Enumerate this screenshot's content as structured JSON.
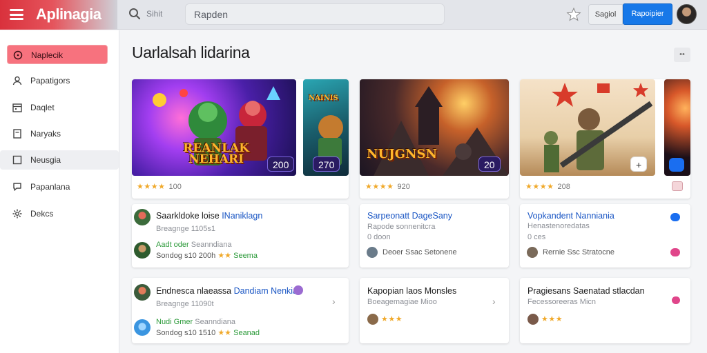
{
  "app": {
    "title": "Aplinagia"
  },
  "search": {
    "label": "Sihit",
    "value": "Rapden"
  },
  "header": {
    "secondary_button": "Sagiol",
    "primary_button": "Rapoipier"
  },
  "sidebar": {
    "items": [
      {
        "label": "Naplecik",
        "icon": "circle-dot-icon"
      },
      {
        "label": "Papatigors",
        "icon": "user-icon"
      },
      {
        "label": "Daqlet",
        "icon": "calendar-icon"
      },
      {
        "label": "Naryaks",
        "icon": "book-icon"
      },
      {
        "label": "Neusgia",
        "icon": "square-icon"
      },
      {
        "label": "Papanlana",
        "icon": "speech-bubble-icon"
      },
      {
        "label": "Dekcs",
        "icon": "gear-icon"
      }
    ]
  },
  "main": {
    "title": "Uarlalsah lidarina",
    "more_label": "••"
  },
  "cards": [
    {
      "banner_text": "REANLAK NEHARI",
      "badge": "200",
      "badge2": "270",
      "side_text": "NAINIS",
      "stars": "★★★★",
      "rating_count": "100"
    },
    {
      "banner_text": "NUJGNSN",
      "badge": "20",
      "stars": "★★★★",
      "rating_count": "920"
    },
    {
      "badge": "+",
      "stars": "★★★★",
      "rating_count": "208"
    }
  ],
  "rows": [
    {
      "title_plain": "Saarkldoke loise ",
      "title_blue": "INaniklagn",
      "sub": "Breagnge 1105s1",
      "green": "Aadt oder",
      "green_after": "Seanndiana",
      "meta": "Sondog s10 200h",
      "meta_green": "Seema"
    },
    {
      "title_blue": "Sarpeonatt DageSany",
      "sub": "Rapode sonnenitcra",
      "sub2": "0 doon",
      "meta": "Deoer Ssac Setonene"
    },
    {
      "title_blue": "Vopkandent Nanniania",
      "sub": "Henastenoredatas",
      "sub2": "0 ces",
      "meta": "Rernie Ssc Stratocne"
    },
    {
      "title_plain": "Endnesca nlaeassa ",
      "title_blue": "Dandiam Nenkia",
      "sub": "Breagnge 11090t",
      "green": "Nudi Gmer",
      "green_after": "Seanndiana",
      "meta": "Sondog s10 1510",
      "meta_green": "Seanad"
    },
    {
      "title_plain": "Kapopian laos Monsles",
      "sub": "Boeagemagiae Mioo",
      "stars": "★★★"
    },
    {
      "title_plain": "Pragiesans Saenatad stlacdan",
      "sub": "Fecessoreeras Micn",
      "stars": "★★★"
    }
  ],
  "colors": {
    "brand": "#d9313c",
    "primary": "#1778e8",
    "active_nav": "#f7727e",
    "star": "#f0a92a",
    "link": "#1a56c4",
    "green": "#2c9a3a"
  }
}
